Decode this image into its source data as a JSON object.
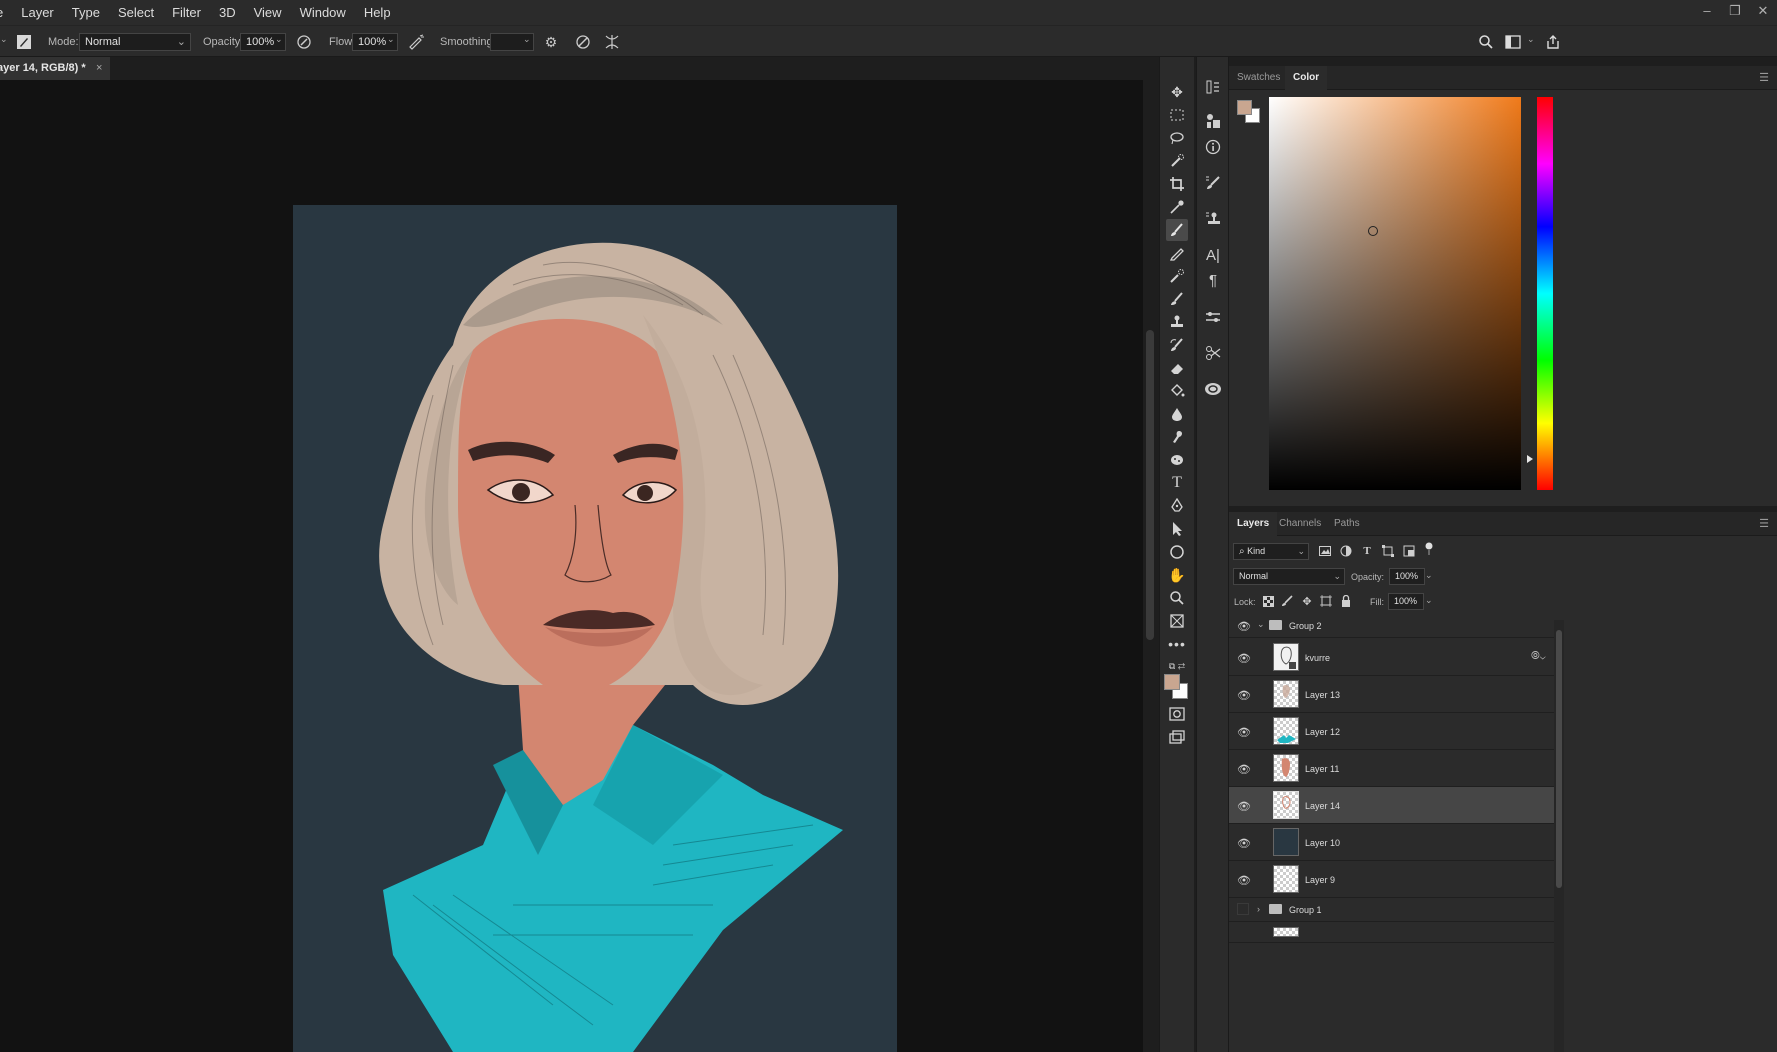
{
  "menu": [
    "Layer",
    "Type",
    "Select",
    "Filter",
    "3D",
    "View",
    "Window",
    "Help"
  ],
  "menu_prefix": "e",
  "options": {
    "mode_label": "Mode:",
    "mode_value": "Normal",
    "opacity_label": "Opacity:",
    "opacity_value": "100%",
    "flow_label": "Flow:",
    "flow_value": "100%",
    "smoothing_label": "Smoothing:",
    "smoothing_value": ""
  },
  "document": {
    "tab_title": "ayer 14, RGB/8) *",
    "close": "×"
  },
  "colors": {
    "foreground": "#c9a690",
    "background": "#ffffff",
    "canvas_bg": "#293741"
  },
  "color_panel": {
    "tabs": [
      "Swatches",
      "Color"
    ],
    "active_tab": "Color"
  },
  "layers_panel": {
    "tabs": [
      "Layers",
      "Channels",
      "Paths"
    ],
    "active_tab": "Layers",
    "filter_kind": "Kind",
    "blend_mode": "Normal",
    "opacity_label": "Opacity:",
    "opacity_value": "100%",
    "lock_label": "Lock:",
    "fill_label": "Fill:",
    "fill_value": "100%",
    "layers": [
      {
        "name": "Group 2",
        "type": "group",
        "visible": true,
        "expanded": true
      },
      {
        "name": "kvurre",
        "type": "layer",
        "visible": true,
        "selected": false
      },
      {
        "name": "Layer 13",
        "type": "layer",
        "visible": true,
        "selected": false
      },
      {
        "name": "Layer 12",
        "type": "layer",
        "visible": true,
        "selected": false
      },
      {
        "name": "Layer 11",
        "type": "layer",
        "visible": true,
        "selected": false
      },
      {
        "name": "Layer 14",
        "type": "layer",
        "visible": true,
        "selected": true
      },
      {
        "name": "Layer 10",
        "type": "layer",
        "visible": true,
        "selected": false
      },
      {
        "name": "Layer 9",
        "type": "layer",
        "visible": true,
        "selected": false
      },
      {
        "name": "Group 1",
        "type": "group",
        "visible": false,
        "expanded": false
      }
    ]
  },
  "tools": [
    "move-tool",
    "marquee-tool",
    "lasso-tool",
    "quick-select-tool",
    "crop-tool",
    "eyedropper-tool",
    "brush-tool",
    "pencil-tool",
    "healing-tool",
    "mixer-brush-tool",
    "clone-stamp-tool",
    "history-brush-tool",
    "eraser-tool",
    "paint-bucket-tool",
    "blur-tool",
    "smudge-tool",
    "sponge-tool",
    "type-tool",
    "pen-tool",
    "path-select-tool",
    "ellipse-tool",
    "hand-tool",
    "zoom-tool",
    "frame-tool",
    "more-tools"
  ]
}
